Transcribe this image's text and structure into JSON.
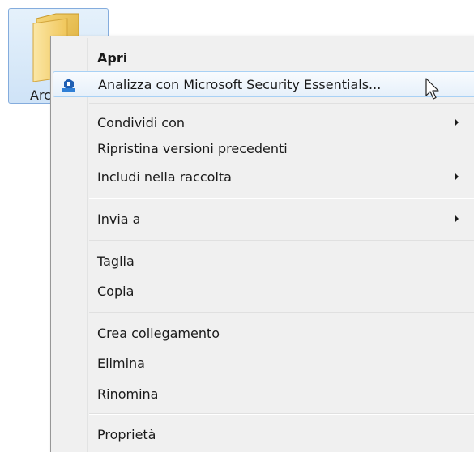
{
  "folder": {
    "label": "Arc",
    "icon": "folder-icon"
  },
  "menu": {
    "items": [
      {
        "label": "Apri",
        "default": true
      },
      {
        "label": "Analizza con Microsoft Security Essentials...",
        "icon": "security-essentials-icon",
        "highlighted": true
      },
      {
        "label": "Condividi con",
        "submenu": true
      },
      {
        "label": "Ripristina versioni precedenti"
      },
      {
        "label": "Includi nella raccolta",
        "submenu": true
      },
      {
        "label": "Invia a",
        "submenu": true
      },
      {
        "label": "Taglia"
      },
      {
        "label": "Copia"
      },
      {
        "label": "Crea collegamento"
      },
      {
        "label": "Elimina"
      },
      {
        "label": "Rinomina"
      },
      {
        "label": "Proprietà"
      }
    ]
  },
  "cursor_icon": "arrow-cursor-icon"
}
